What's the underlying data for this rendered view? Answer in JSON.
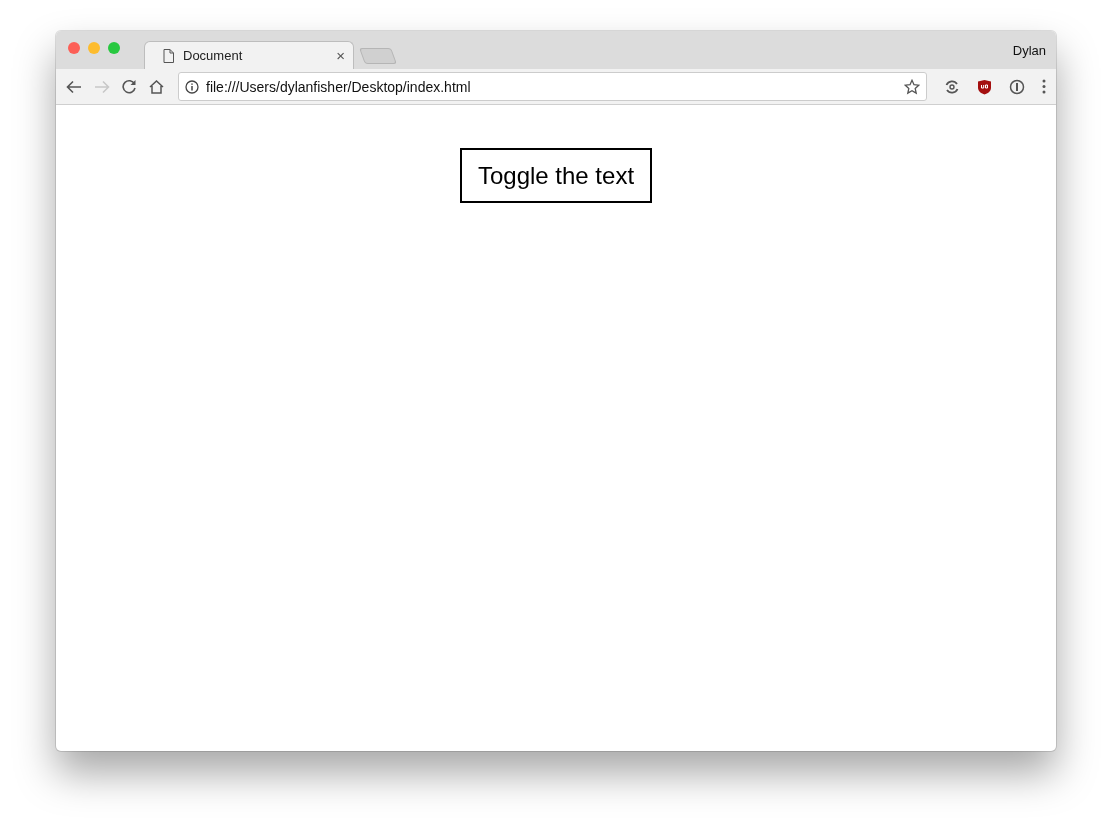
{
  "tabs": [
    {
      "title": "Document",
      "close": "×",
      "selected": true
    }
  ],
  "profile": "Dylan",
  "nav": {
    "back_disabled": false,
    "forward_disabled": true
  },
  "address": {
    "value": "file:///Users/dylanfisher/Desktop/index.html"
  },
  "page": {
    "button": "Toggle the text"
  }
}
